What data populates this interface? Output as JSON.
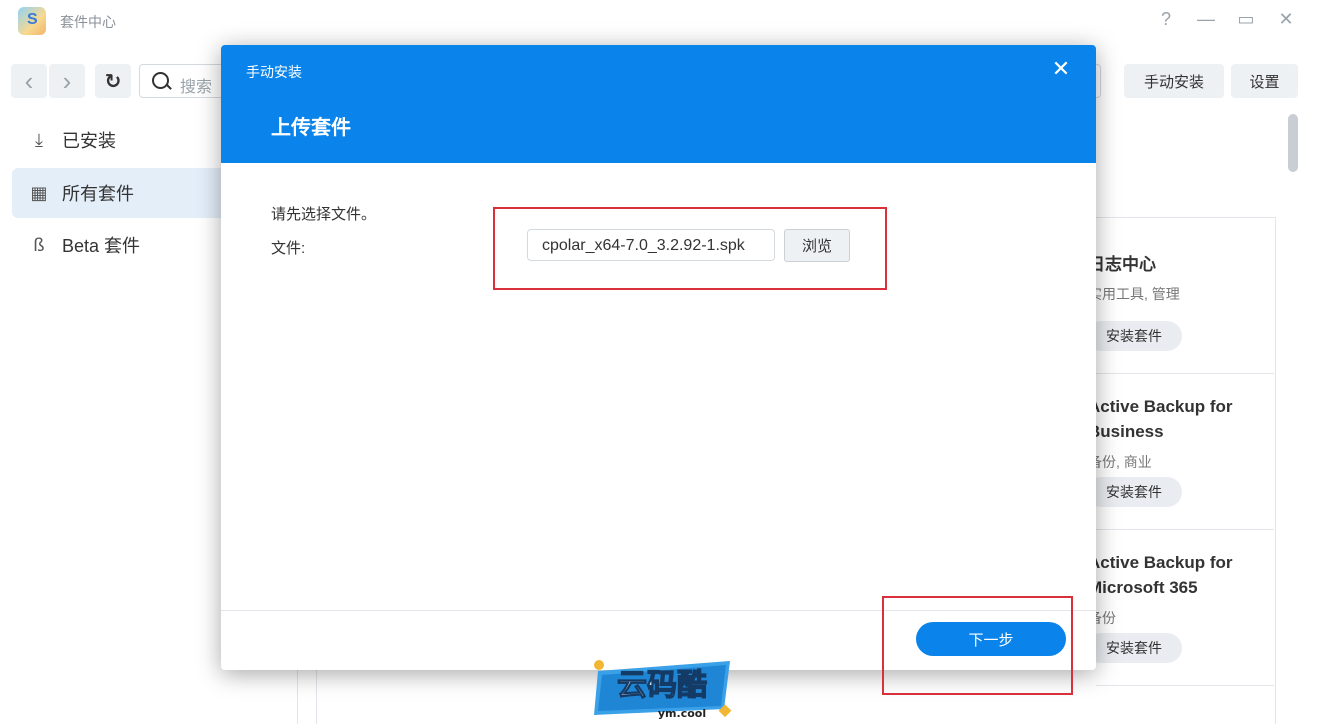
{
  "window": {
    "title": "套件中心",
    "controls": {
      "help": "?",
      "minimize": "—",
      "maximize": "▭",
      "close": "✕"
    }
  },
  "toolbar": {
    "back_icon": "‹",
    "forward_icon": "›",
    "refresh_icon": "↻",
    "search_placeholder": "搜索",
    "manual_install_label": "手动安装",
    "settings_label": "设置"
  },
  "sidebar": {
    "items": [
      {
        "label": "已安装",
        "icon": "download-icon",
        "glyph": "⤓",
        "active": false
      },
      {
        "label": "所有套件",
        "icon": "grid-icon",
        "glyph": "▦",
        "active": true
      },
      {
        "label": "Beta 套件",
        "icon": "beta-icon",
        "glyph": "ß",
        "active": false
      }
    ]
  },
  "packages": [
    {
      "name": "日志中心",
      "category": "实用工具, 管理",
      "install_label": "安装套件"
    },
    {
      "name": "Active Backup for Business",
      "category": "备份, 商业",
      "install_label": "安装套件"
    },
    {
      "name": "Active Backup for Microsoft 365",
      "category": "备份",
      "install_label": "安装套件"
    }
  ],
  "dialog": {
    "title": "手动安装",
    "heading": "上传套件",
    "close_icon": "✕",
    "hint": "请先选择文件。",
    "file_label": "文件:",
    "file_value": "cpolar_x64-7.0_3.2.92-1.spk",
    "browse_label": "浏览",
    "next_label": "下一步"
  },
  "colors": {
    "accent": "#0a84ea",
    "highlight": "#d9303c"
  },
  "watermark": {
    "text": "云码酷",
    "subtext": "ym.cool"
  }
}
